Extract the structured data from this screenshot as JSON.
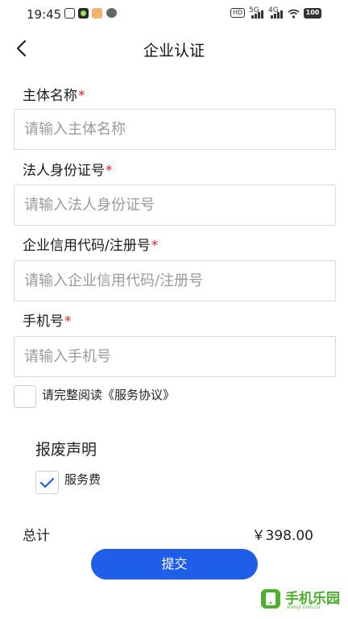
{
  "status_bar": {
    "time": "19:45",
    "hd_label": "HD",
    "net1": "5G",
    "net2": "4G",
    "battery": "100"
  },
  "header": {
    "title": "企业认证"
  },
  "form": {
    "fields": [
      {
        "label": "主体名称",
        "required_mark": "*",
        "placeholder": "请输入主体名称",
        "value": ""
      },
      {
        "label": "法人身份证号",
        "required_mark": "*",
        "placeholder": "请输入法人身份证号",
        "value": ""
      },
      {
        "label": "企业信用代码/注册号",
        "required_mark": "*",
        "placeholder": "请输入企业信用代码/注册号",
        "value": ""
      },
      {
        "label": "手机号",
        "required_mark": "*",
        "placeholder": "请输入手机号",
        "value": ""
      }
    ]
  },
  "agreement": {
    "text": "请完整阅读《服务协议》",
    "checked": false
  },
  "section": {
    "title": "报废声明",
    "service_label": "服务费",
    "service_checked": true
  },
  "total": {
    "label": "总计",
    "value": "￥398.00"
  },
  "submit": {
    "label": "提交"
  },
  "watermark": {
    "text": "手机乐园",
    "url": "shouji.com.cn"
  },
  "colors": {
    "primary": "#1e5ee8",
    "required": "#e02020",
    "check": "#1e5ee8",
    "watermark": "#4caf2e"
  }
}
